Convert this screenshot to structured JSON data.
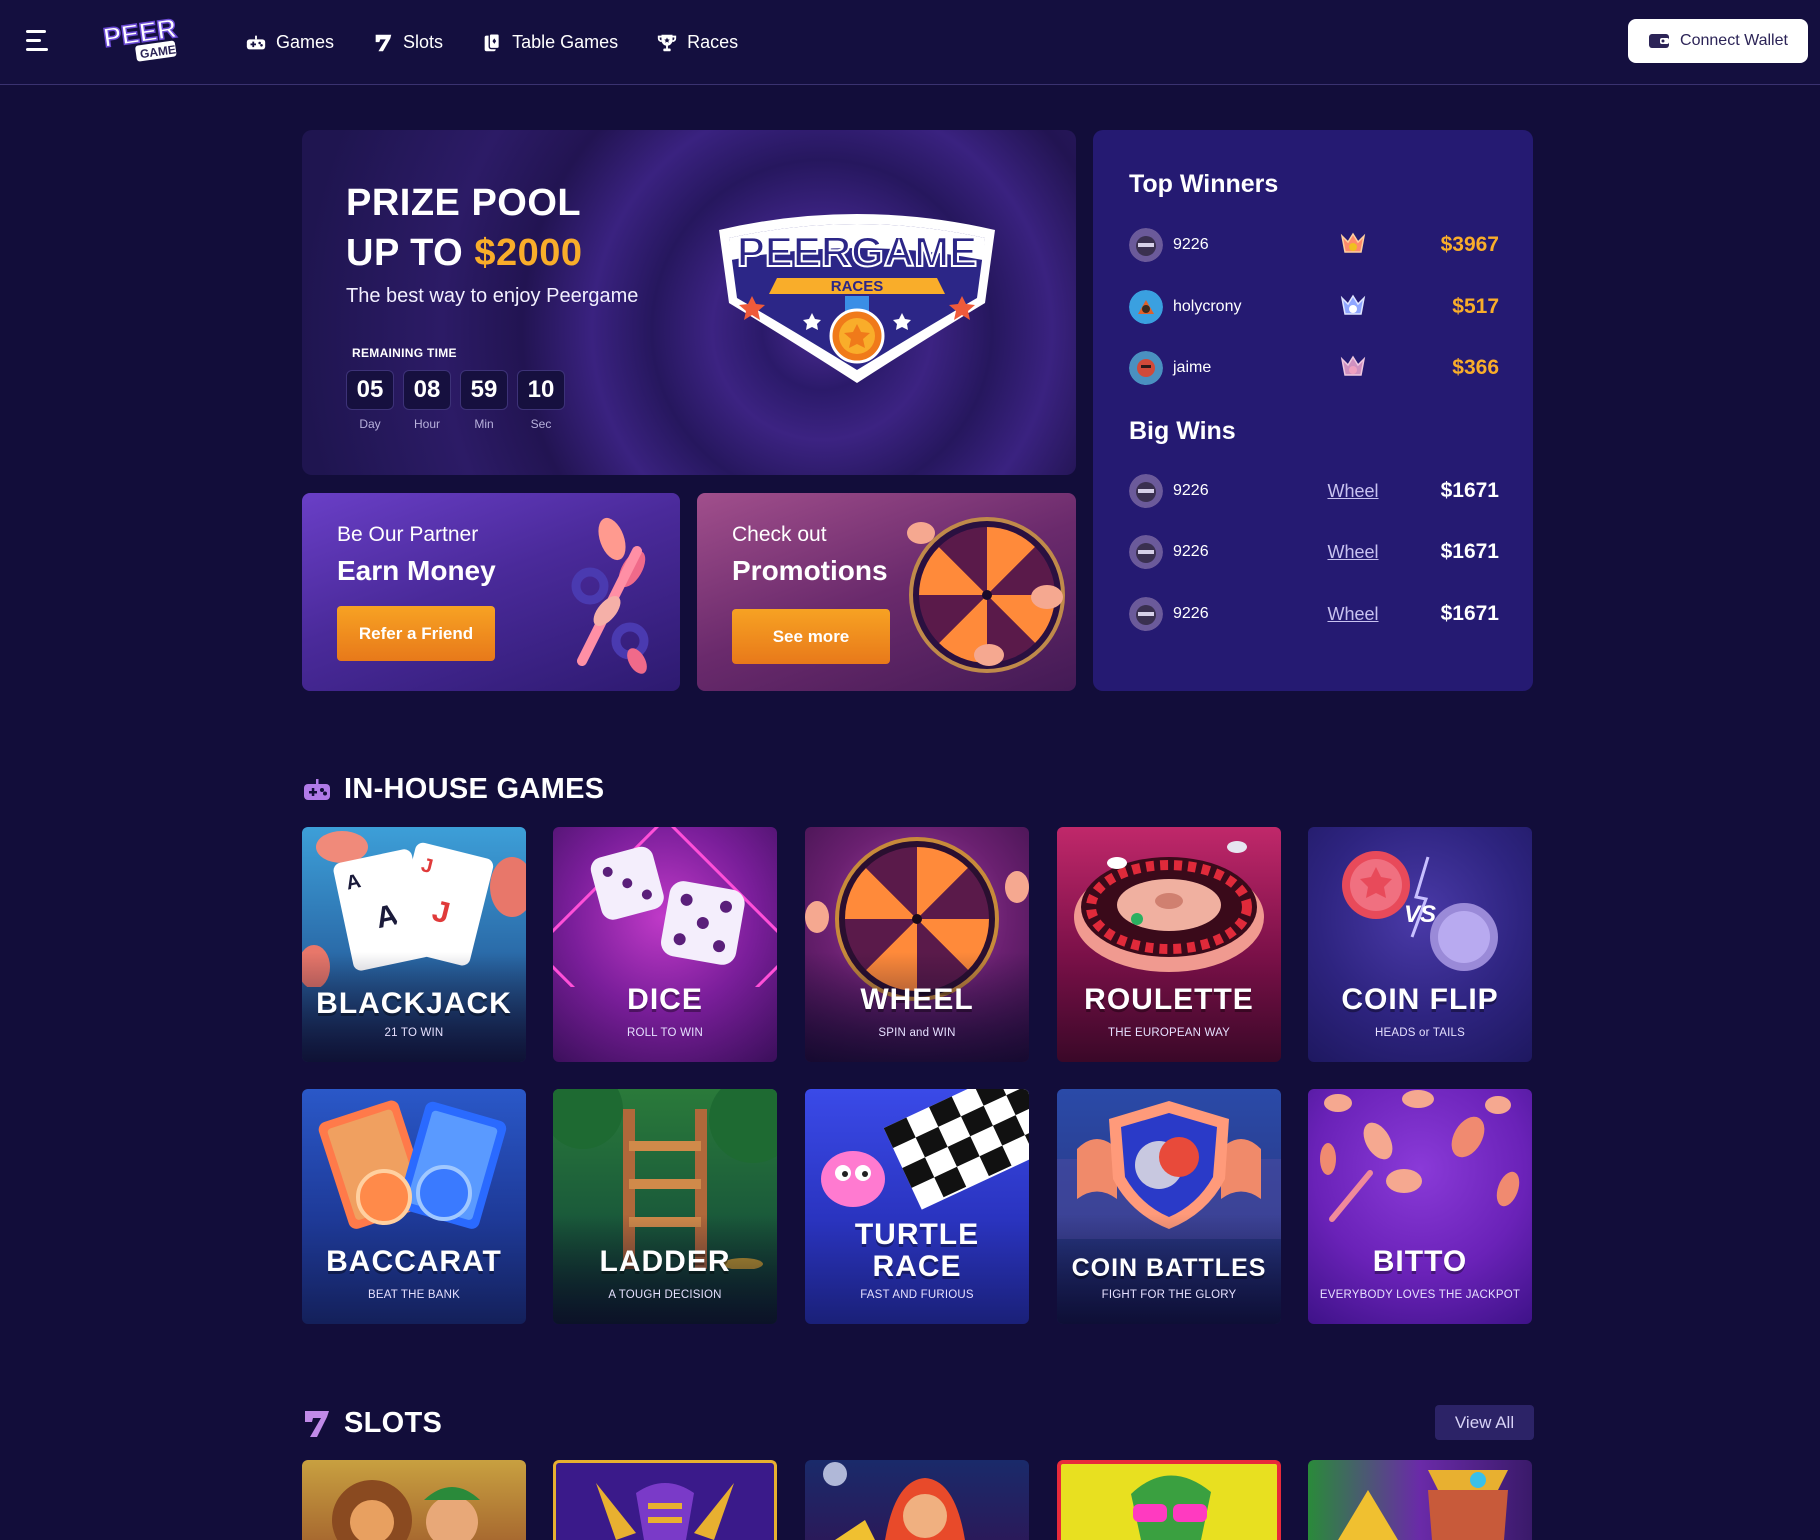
{
  "header": {
    "logo_text": "PEER GAME",
    "nav": [
      {
        "label": "Games",
        "icon": "gamepad-icon"
      },
      {
        "label": "Slots",
        "icon": "seven-icon"
      },
      {
        "label": "Table Games",
        "icon": "cards-icon"
      },
      {
        "label": "Races",
        "icon": "trophy-icon"
      }
    ],
    "connect_wallet": "Connect Wallet"
  },
  "hero": {
    "title_line1": "PRIZE POOL",
    "title_line2_prefix": "UP TO ",
    "title_line2_amount": "$2000",
    "subtitle": "The best way to enjoy Peergame",
    "remaining_label": "REMAINING TIME",
    "timer": [
      {
        "value": "05",
        "unit": "Day"
      },
      {
        "value": "08",
        "unit": "Hour"
      },
      {
        "value": "59",
        "unit": "Min"
      },
      {
        "value": "10",
        "unit": "Sec"
      }
    ],
    "badge_title": "PEERGAME",
    "badge_ribbon": "RACES"
  },
  "partner_card": {
    "kicker": "Be Our Partner",
    "headline": "Earn Money",
    "button": "Refer a Friend"
  },
  "promo_card": {
    "kicker": "Check out",
    "headline": "Promotions",
    "button": "See more"
  },
  "top_winners": {
    "title": "Top Winners",
    "rows": [
      {
        "name": "9226",
        "amount": "$3967",
        "medal": "gold"
      },
      {
        "name": "holycrony",
        "amount": "$517",
        "medal": "silver"
      },
      {
        "name": "jaime",
        "amount": "$366",
        "medal": "bronze"
      }
    ]
  },
  "big_wins": {
    "title": "Big Wins",
    "rows": [
      {
        "name": "9226",
        "game": "Wheel",
        "amount": "$1671"
      },
      {
        "name": "9226",
        "game": "Wheel",
        "amount": "$1671"
      },
      {
        "name": "9226",
        "game": "Wheel",
        "amount": "$1671"
      }
    ]
  },
  "inhouse": {
    "title": "IN-HOUSE GAMES",
    "games": [
      {
        "name": "BLACKJACK",
        "sub": "21 TO WIN"
      },
      {
        "name": "DICE",
        "sub": "ROLL TO WIN"
      },
      {
        "name": "WHEEL",
        "sub": "SPIN and WIN"
      },
      {
        "name": "ROULETTE",
        "sub": "THE EUROPEAN WAY"
      },
      {
        "name": "COIN FLIP",
        "sub": "HEADS or TAILS",
        "vs": "VS"
      },
      {
        "name": "BACCARAT",
        "sub": "BEAT THE BANK"
      },
      {
        "name": "LADDER",
        "sub": "A TOUGH DECISION"
      },
      {
        "name_line1": "TURTLE",
        "name_line2": "RACE",
        "sub": "FAST AND FURIOUS"
      },
      {
        "name": "COIN BATTLES",
        "sub": "FIGHT FOR THE GLORY"
      },
      {
        "name": "BITTO",
        "sub": "EVERYBODY LOVES THE JACKPOT"
      }
    ]
  },
  "slots": {
    "title": "SLOTS",
    "view_all": "View All"
  },
  "colors": {
    "background": "#120d3a",
    "accent_gold": "#f9ad2a",
    "button_orange": "#e8791a",
    "panel": "#251a72"
  }
}
